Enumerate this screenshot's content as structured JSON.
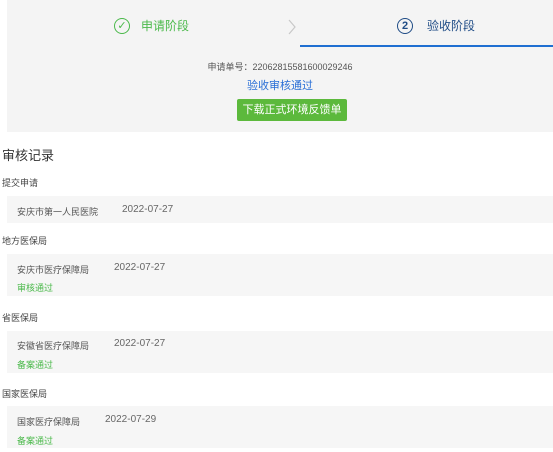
{
  "steps": [
    {
      "label": "申请阶段",
      "icon": "check-icon",
      "state": "done"
    },
    {
      "label": "验收阶段",
      "number": "2",
      "icon": "number-icon",
      "state": "active"
    }
  ],
  "order_line": "申请单号：22062815581600029246",
  "status_text": "验收审核通过",
  "download_button": "下载正式环境反馈单",
  "section_title": "审核记录",
  "records": [
    {
      "stage": "提交申请",
      "org": "安庆市第一人民医院",
      "date": "2022-07-27",
      "result": ""
    },
    {
      "stage": "地方医保局",
      "org": "安庆市医疗保障局",
      "date": "2022-07-27",
      "result": "审核通过"
    },
    {
      "stage": "省医保局",
      "org": "安徽省医疗保障局",
      "date": "2022-07-27",
      "result": "备案通过"
    },
    {
      "stage": "国家医保局",
      "org": "国家医疗保障局",
      "date": "2022-07-29",
      "result": "备案通过"
    }
  ],
  "colors": {
    "success": "#4bb94b",
    "primary": "#1f4c86",
    "link": "#2a6fd6",
    "button": "#5cb93c"
  }
}
